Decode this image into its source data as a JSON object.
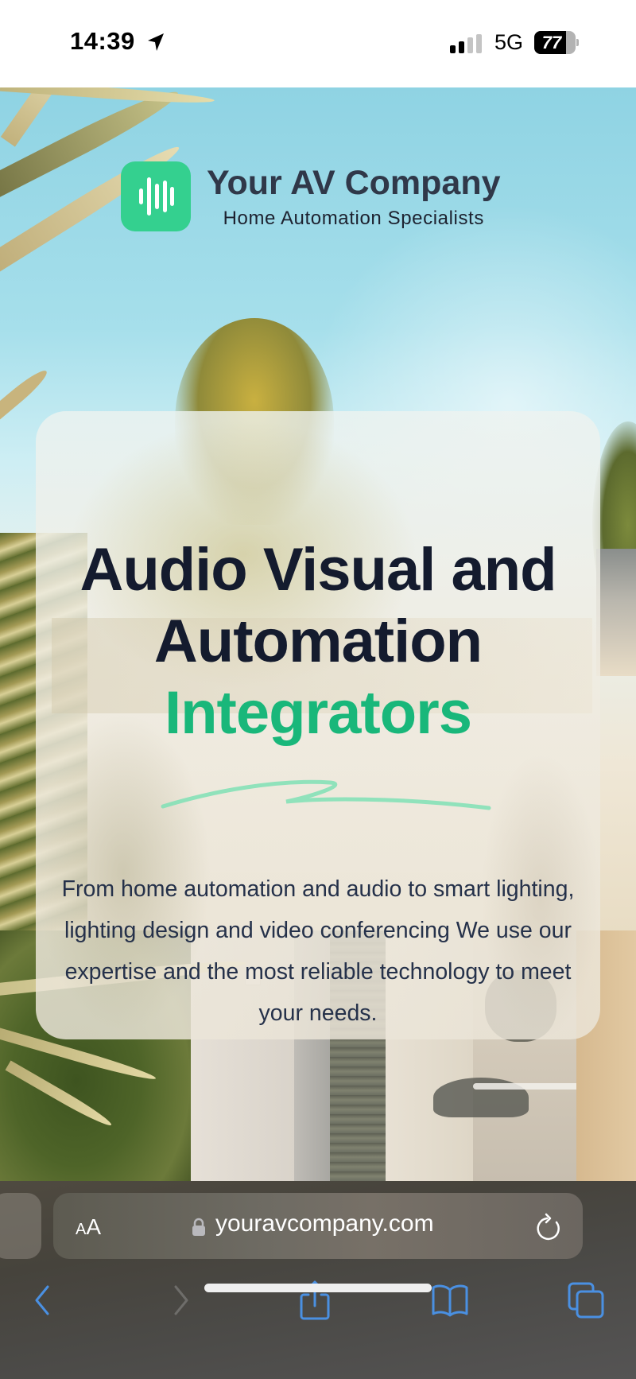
{
  "status_bar": {
    "time": "14:39",
    "location_icon": "location-arrow-icon",
    "signal_bars_active": 2,
    "signal_bars_total": 4,
    "network": "5G",
    "battery_percent": 77
  },
  "brand": {
    "logo_icon": "sound-wave-icon",
    "name": "Your AV Company",
    "tagline": "Home Automation Specialists",
    "logo_color": "#34d08f",
    "name_color": "#303849"
  },
  "hero": {
    "headline_line1": "Audio Visual and",
    "headline_line2": "Automation",
    "headline_accent": "Integrators",
    "accent_color": "#19b77a",
    "headline_color": "#141b2e",
    "body": "From home automation and audio to smart lighting, lighting design and video conferencing We use our expertise and the most reliable technology to meet your needs."
  },
  "browser": {
    "text_size_small": "A",
    "text_size_big": "A",
    "url": "youravcompany.com",
    "secure_icon": "lock-icon",
    "reload_icon": "reload-icon",
    "toolbar": [
      {
        "icon": "back-chevron-icon",
        "enabled": true
      },
      {
        "icon": "forward-chevron-icon",
        "enabled": false
      },
      {
        "icon": "share-icon",
        "enabled": true
      },
      {
        "icon": "bookmarks-book-icon",
        "enabled": true
      },
      {
        "icon": "tabs-icon",
        "enabled": true
      }
    ],
    "accent_color": "#4a90e2"
  }
}
